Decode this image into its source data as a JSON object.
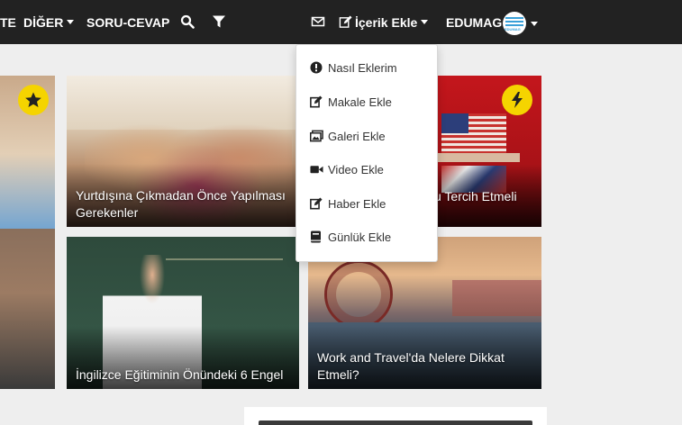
{
  "navbar": {
    "partial_item": "TE",
    "more_label": "DİĞER",
    "qa_label": "SORU-CEVAP",
    "search_icon": "search-icon",
    "filter_icon": "filter-icon",
    "mail_icon": "envelope-icon",
    "add_content_label": "İçerik Ekle",
    "user_label": "EDUMAG",
    "avatar_text": "EDUMAG"
  },
  "dropdown": {
    "items": [
      {
        "label": "Nasıl Eklerim",
        "icon": "exclamation-circle-icon"
      },
      {
        "label": "Makale Ekle",
        "icon": "edit-icon"
      },
      {
        "label": "Galeri Ekle",
        "icon": "images-icon"
      },
      {
        "label": "Video Ekle",
        "icon": "video-camera-icon"
      },
      {
        "label": "Haber Ekle",
        "icon": "edit-icon"
      },
      {
        "label": "Günlük Ekle",
        "icon": "book-icon"
      }
    ]
  },
  "cards": [
    {
      "title": "Yurtdışına Çıkmadan Önce Yapılması Gerekenler"
    },
    {
      "title": "u Tercih Etmeli"
    },
    {
      "title": "İngilizce Eğitiminin Önündeki 6 Engel"
    },
    {
      "title": "Work and Travel'da Nelere Dikkat Etmeli?"
    }
  ],
  "badges": {
    "featured": "star-icon",
    "trending": "bolt-icon"
  },
  "colors": {
    "navbar": "#222222",
    "badge": "#f5d400",
    "page_bg": "#eeeeee"
  }
}
